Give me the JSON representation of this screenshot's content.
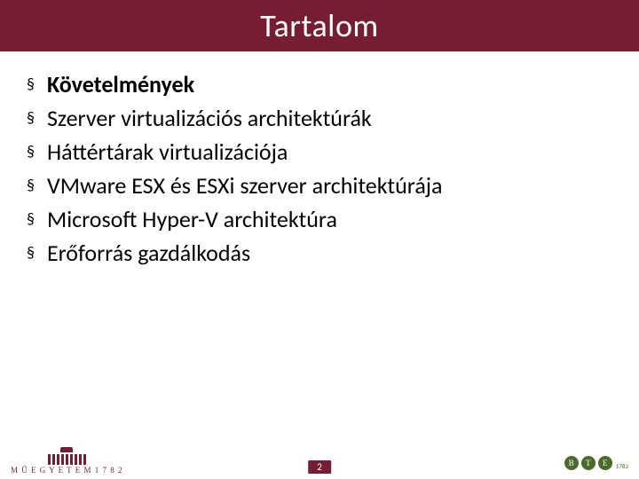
{
  "title": "Tartalom",
  "items": [
    {
      "label": "Követelmények",
      "bold": true
    },
    {
      "label": "Szerver virtualizációs architektúrák",
      "bold": false
    },
    {
      "label": "Háttértárak virtualizációja",
      "bold": false
    },
    {
      "label": "VMware ESX és ESXi szerver architektúrája",
      "bold": false
    },
    {
      "label": "Microsoft Hyper-V architektúra",
      "bold": false
    },
    {
      "label": "Erőforrás gazdálkodás",
      "bold": false
    }
  ],
  "page_number": "2",
  "footer_left_text": "M Ű E G Y E T E M   1 7 8 2",
  "footer_right": {
    "letters": [
      "B",
      "T",
      "E"
    ],
    "year": "1782"
  }
}
